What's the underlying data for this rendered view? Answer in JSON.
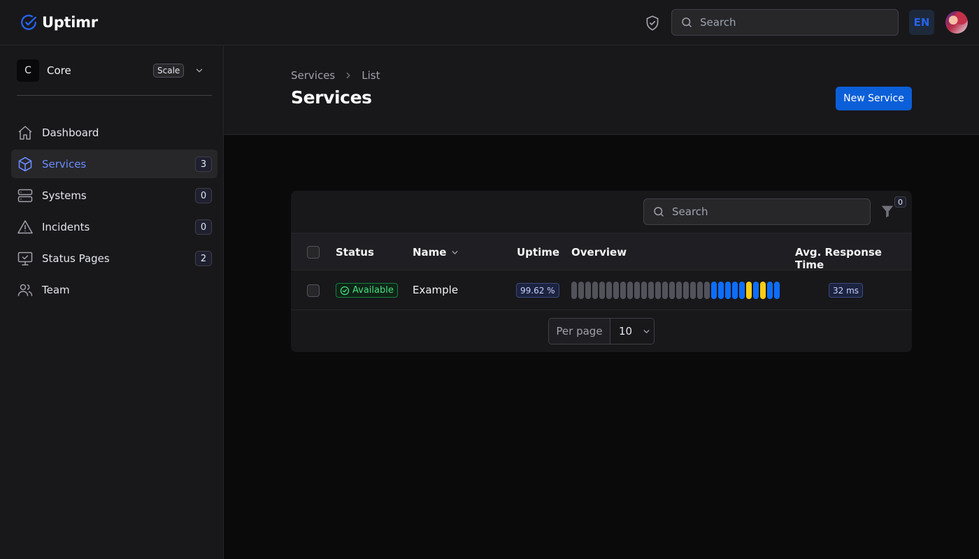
{
  "app": {
    "name": "Uptimr"
  },
  "topbar": {
    "search_placeholder": "Search",
    "language": "EN"
  },
  "sidebar": {
    "tenant": {
      "initial": "C",
      "name": "Core",
      "plan": "Scale"
    },
    "items": [
      {
        "label": "Dashboard",
        "icon": "home-icon",
        "count": null,
        "active": false
      },
      {
        "label": "Services",
        "icon": "cube-icon",
        "count": "3",
        "active": true
      },
      {
        "label": "Systems",
        "icon": "server-icon",
        "count": "0",
        "active": false
      },
      {
        "label": "Incidents",
        "icon": "warning-icon",
        "count": "0",
        "active": false
      },
      {
        "label": "Status Pages",
        "icon": "monitor-icon",
        "count": "2",
        "active": false
      },
      {
        "label": "Team",
        "icon": "users-icon",
        "count": null,
        "active": false
      }
    ]
  },
  "header": {
    "breadcrumb": [
      "Services",
      "List"
    ],
    "title": "Services",
    "new_button": "New Service"
  },
  "table": {
    "search_placeholder": "Search",
    "filter_count": "0",
    "columns": {
      "status": "Status",
      "name": "Name",
      "uptime": "Uptime",
      "overview": "Overview",
      "avg_response": "Avg. Response Time"
    },
    "rows": [
      {
        "status": "Available",
        "name": "Example",
        "uptime": "99.62 %",
        "overview": [
          "gray",
          "gray",
          "gray",
          "gray",
          "gray",
          "gray",
          "gray",
          "gray",
          "gray",
          "gray",
          "gray",
          "gray",
          "gray",
          "gray",
          "gray",
          "gray",
          "gray",
          "gray",
          "gray",
          "gray",
          "blue",
          "blue",
          "blue",
          "blue",
          "blue",
          "yellow",
          "blue",
          "yellow",
          "blue",
          "blue"
        ],
        "avg_response": "32 ms"
      }
    ],
    "per_page_label": "Per page",
    "per_page_value": "10"
  },
  "colors": {
    "accent": "#0b5fd8",
    "active_nav": "#6b8cff",
    "bar_gray": "#52525b",
    "bar_blue": "#0d6efd",
    "bar_yellow": "#facc15",
    "status_green": "#4ade80"
  }
}
